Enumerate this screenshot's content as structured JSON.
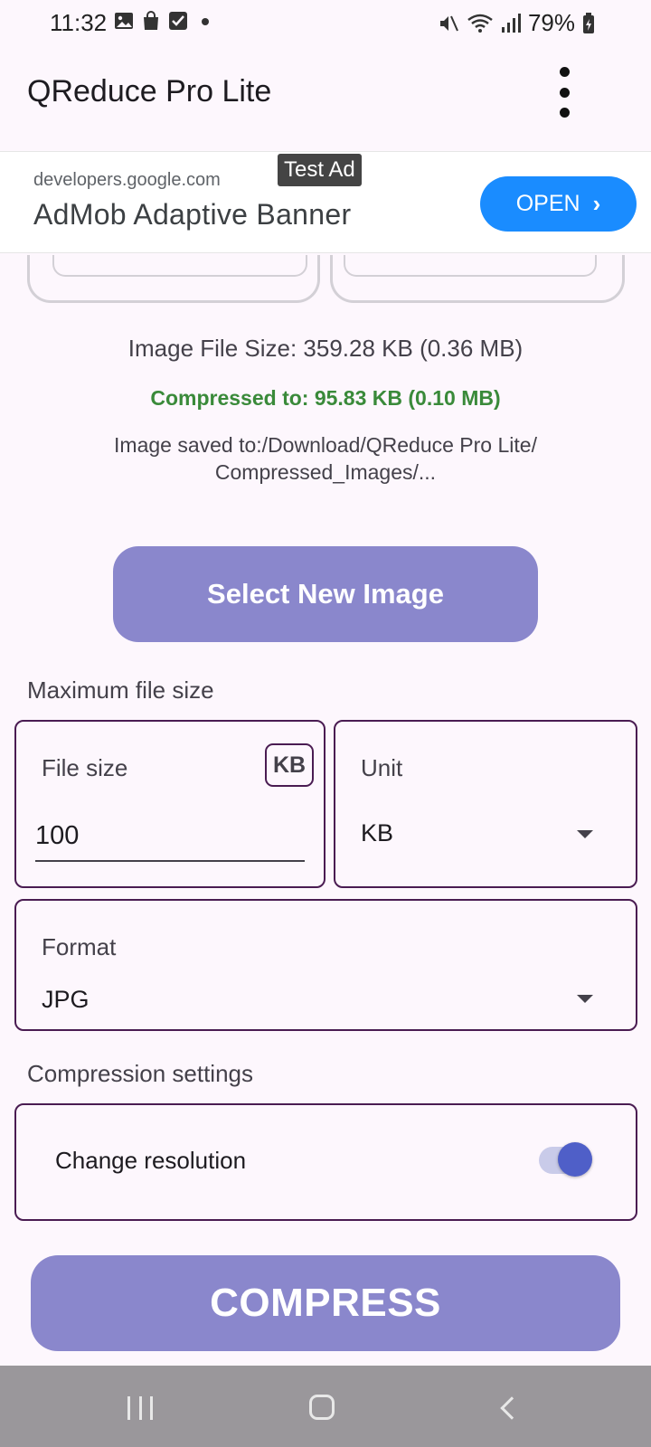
{
  "status_bar": {
    "time": "11:32",
    "battery_percent": "79%"
  },
  "app_bar": {
    "title": "QReduce Pro Lite"
  },
  "ad": {
    "test_label": "Test Ad",
    "domain": "developers.google.com",
    "title": "AdMob Adaptive Banner",
    "open_label": "OPEN",
    "accent_color": "#1a8cff"
  },
  "info": {
    "file_size": "Image File Size: 359.28 KB (0.36 MB)",
    "compressed": "Compressed to: 95.83 KB (0.10 MB)",
    "saved_line1": "Image saved to:/Download/QReduce Pro Lite/",
    "saved_line2": "Compressed_Images/..."
  },
  "select_button": {
    "label": "Select New Image"
  },
  "max_size": {
    "section_label": "Maximum file size",
    "file_size_label": "File size",
    "file_size_badge": "KB",
    "file_size_value": "100",
    "unit_label": "Unit",
    "unit_value": "KB"
  },
  "format": {
    "label": "Format",
    "value": "JPG"
  },
  "compression": {
    "section_label": "Compression settings",
    "change_resolution_label": "Change resolution",
    "change_resolution_on": true
  },
  "compress_button": {
    "label": "COMPRESS",
    "color": "#8a87cc"
  }
}
